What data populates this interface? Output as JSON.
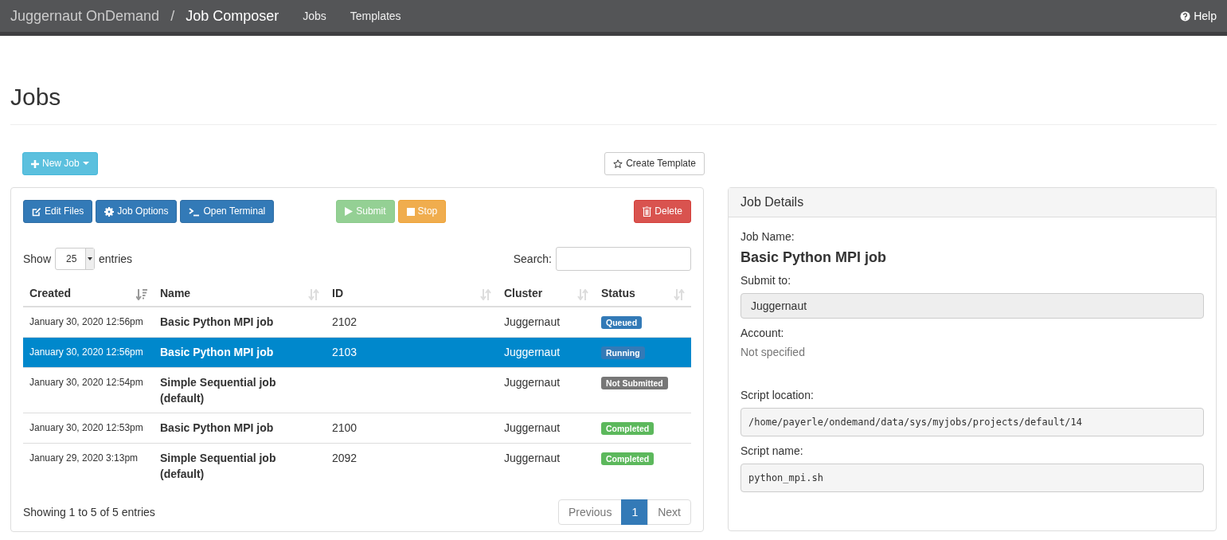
{
  "navbar": {
    "brand": "Juggernaut OnDemand",
    "separator": "/",
    "app": "Job Composer",
    "links": [
      "Jobs",
      "Templates"
    ],
    "help": "Help"
  },
  "page_title": "Jobs",
  "new_job_button": "New Job",
  "create_template_button": "Create Template",
  "toolbar": [
    {
      "label": "Edit Files",
      "kind": "primary",
      "disabled": false
    },
    {
      "label": "Job Options",
      "kind": "primary",
      "disabled": false
    },
    {
      "label": "Open Terminal",
      "kind": "primary",
      "disabled": false
    },
    {
      "label": "Submit",
      "kind": "success",
      "disabled": true
    },
    {
      "label": "Stop",
      "kind": "warning",
      "disabled": false
    },
    {
      "label": "Delete",
      "kind": "danger",
      "disabled": false
    }
  ],
  "length": {
    "before": "Show",
    "value": "25",
    "after": "entries"
  },
  "search": {
    "label": "Search:"
  },
  "table": {
    "columns": [
      {
        "label": "Created",
        "sorted": true
      },
      {
        "label": "Name",
        "sorted": false
      },
      {
        "label": "ID",
        "sorted": false
      },
      {
        "label": "Cluster",
        "sorted": false
      },
      {
        "label": "Status",
        "sorted": false
      }
    ],
    "rows": [
      {
        "created": "January 30, 2020 12:56pm",
        "name": "Basic Python MPI job",
        "id": "2102",
        "cluster": "Juggernaut",
        "status": "Queued",
        "color": "#337ab7",
        "selected": false
      },
      {
        "created": "January 30, 2020 12:56pm",
        "name": "Basic Python MPI job",
        "id": "2103",
        "cluster": "Juggernaut",
        "status": "Running",
        "color": "#337ab7",
        "selected": true
      },
      {
        "created": "January 30, 2020 12:54pm",
        "name": "Simple Sequential job (default)",
        "id": "",
        "cluster": "Juggernaut",
        "status": "Not Submitted",
        "color": "#777777",
        "selected": false
      },
      {
        "created": "January 30, 2020 12:53pm",
        "name": "Basic Python MPI job",
        "id": "2100",
        "cluster": "Juggernaut",
        "status": "Completed",
        "color": "#5cb85c",
        "selected": false
      },
      {
        "created": "January 29, 2020 3:13pm",
        "name": "Simple Sequential job (default)",
        "id": "2092",
        "cluster": "Juggernaut",
        "status": "Completed",
        "color": "#5cb85c",
        "selected": false
      }
    ]
  },
  "info": "Showing 1 to 5 of 5 entries",
  "pagination": [
    {
      "label": "Previous",
      "selected": false
    },
    {
      "label": "1",
      "selected": true
    },
    {
      "label": "Next",
      "selected": false
    }
  ],
  "details": {
    "title": "Job Details",
    "fields": [
      {
        "label": "Job Name:",
        "value": "Basic Python MPI job",
        "kind": "heading"
      },
      {
        "label": "Submit to:",
        "value": "Juggernaut",
        "kind": "field"
      },
      {
        "label": "Account:",
        "value": "Not specified",
        "kind": "muted"
      },
      {
        "label": "Script location:",
        "value": "/home/payerle/ondemand/data/sys/myjobs/projects/default/14",
        "kind": "code"
      },
      {
        "label": "Script name:",
        "value": "python_mpi.sh",
        "kind": "code"
      }
    ]
  }
}
